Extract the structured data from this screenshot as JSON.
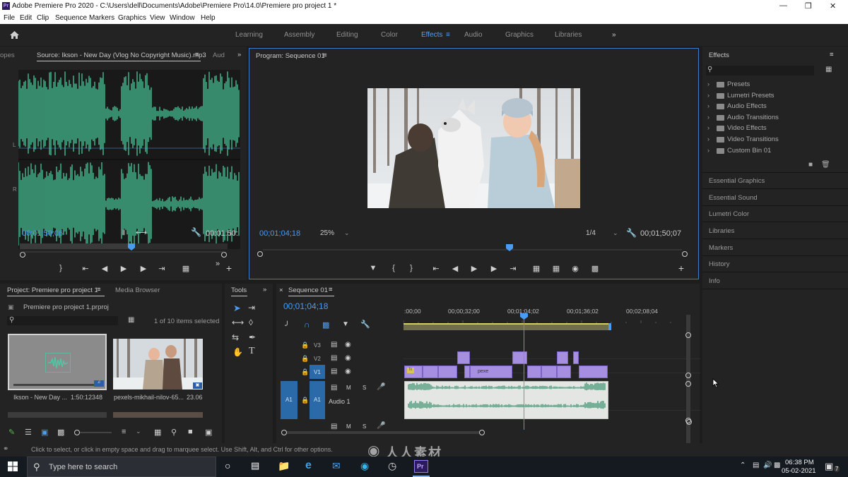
{
  "window": {
    "title": "Adobe Premiere Pro 2020 - C:\\Users\\dell\\Documents\\Adobe\\Premiere Pro\\14.0\\Premiere pro project 1 *"
  },
  "menu": [
    "File",
    "Edit",
    "Clip",
    "Sequence",
    "Markers",
    "Graphics",
    "View",
    "Window",
    "Help"
  ],
  "workspaces": {
    "tabs": [
      "Learning",
      "Assembly",
      "Editing",
      "Color",
      "Effects",
      "Audio",
      "Graphics",
      "Libraries"
    ],
    "active": "Effects",
    "more": "»"
  },
  "source_panel": {
    "tab_left": "opes",
    "tab": "Source: Ikson - New Day (Vlog No Copyright Music).mp3",
    "tab_right": "Aud",
    "channel_labels": [
      "L",
      "R"
    ],
    "timecode_left": "00;01;50;06",
    "timecode_right": "00:01:50:",
    "playhead_fraction": 0.65
  },
  "program_panel": {
    "tab": "Program: Sequence 01",
    "timecode_left": "00;01;04;18",
    "zoom": "25%",
    "resolution": "1/4",
    "timecode_right": "00;01;50;07",
    "playhead_fraction": 0.59
  },
  "effects_panel": {
    "title": "Effects",
    "items": [
      "Presets",
      "Lumetri Presets",
      "Audio Effects",
      "Audio Transitions",
      "Video Effects",
      "Video Transitions",
      "Custom Bin 01"
    ],
    "other_panels": [
      "Essential Graphics",
      "Essential Sound",
      "Lumetri Color",
      "Libraries",
      "Markers",
      "History",
      "Info"
    ]
  },
  "project_panel": {
    "tab": "Project: Premiere pro project 1",
    "tab2": "Media Browser",
    "file": "Premiere pro project 1.prproj",
    "selection": "1 of 10 items selected",
    "items": [
      {
        "name": "Ikson - New Day ...",
        "duration": "1:50:12348"
      },
      {
        "name": "pexels-mikhail-nilov-65...",
        "duration": "23.06"
      }
    ]
  },
  "tools_panel": {
    "title": "Tools"
  },
  "timeline": {
    "tab": "Sequence 01",
    "timecode": "00;01;04;18",
    "ruler": [
      ":00;00",
      "00;00;32;00",
      "00;01;04;02",
      "00;01;36;02",
      "00;02;08;04"
    ],
    "tracks": {
      "video": [
        "V3",
        "V2",
        "V1"
      ],
      "audio": "A1",
      "audio_name": "Audio 1",
      "source_patch_v": "V1",
      "source_patch_a": "A1",
      "mute": "M",
      "solo": "S"
    },
    "clip_labels": [
      "fx",
      "pexe"
    ]
  },
  "status_bar": {
    "text": "Click to select, or click in empty space and drag to marquee select. Use Shift, Alt, and Ctrl for other options."
  },
  "taskbar": {
    "search_placeholder": "Type here to search",
    "time": "06:38 PM",
    "date": "05-02-2021",
    "notification_count": "7"
  },
  "watermark": "RRCG 人人素材",
  "colors": {
    "accent_blue": "#4a9bf2",
    "waveform_green": "#3fa882",
    "clip_purple": "#a68fe0",
    "panel_bg": "#232323"
  }
}
